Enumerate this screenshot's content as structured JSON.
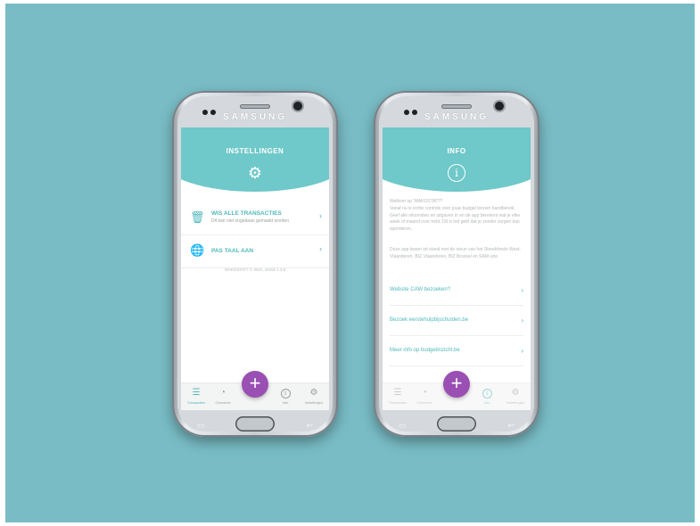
{
  "phone_brand": "SAMSUNG",
  "colors": {
    "background": "#79bcc5",
    "accent": "#6fc8c9",
    "fab": "#9a4fb3"
  },
  "settings_screen": {
    "title": "INSTELLINGEN",
    "header_icon": "gear-icon",
    "rows": [
      {
        "icon": "trash-icon",
        "title": "WIS ALLE TRANSACTIES",
        "subtitle": "Dit kan niet ongedaan gemaakt worden"
      },
      {
        "icon": "globe-icon",
        "title": "PAS TAAL AAN",
        "subtitle": ""
      }
    ],
    "footnote": "WAKOSTAT? © 2021, versie 1.3.8"
  },
  "info_screen": {
    "title": "INFO",
    "header_icon": "info-icon",
    "welcome": "Welkom op 'WAKOSTAT?'!",
    "paragraph1": "Vanaf nu is echte controle over jouw budget binnen handbereik. Geef alle inkomsten en uitgaven in en de app berekent wat je elke week of maand over hebt. Dit is het geld dat je zonder zorgen kan spenderen.",
    "paragraph2": "Deze app kwam tot stand met de steun van het Streekfonds West-Vlaanderen, BIZ Vlaanderen, BIZ Brussel en SAM vzw.",
    "links": [
      "Website CAW bezoeken?",
      "Bezoek eerstehulpbijschulden.be",
      "Meer info op budgetinzicht.be"
    ]
  },
  "tabs": [
    {
      "label": "Transacties",
      "icon": "list-icon"
    },
    {
      "label": "Overzicht",
      "icon": "pie-chart-icon"
    },
    {
      "label": "Info",
      "icon": "info-icon"
    },
    {
      "label": "Instellingen",
      "icon": "gear-icon"
    }
  ],
  "fab_label": "+"
}
